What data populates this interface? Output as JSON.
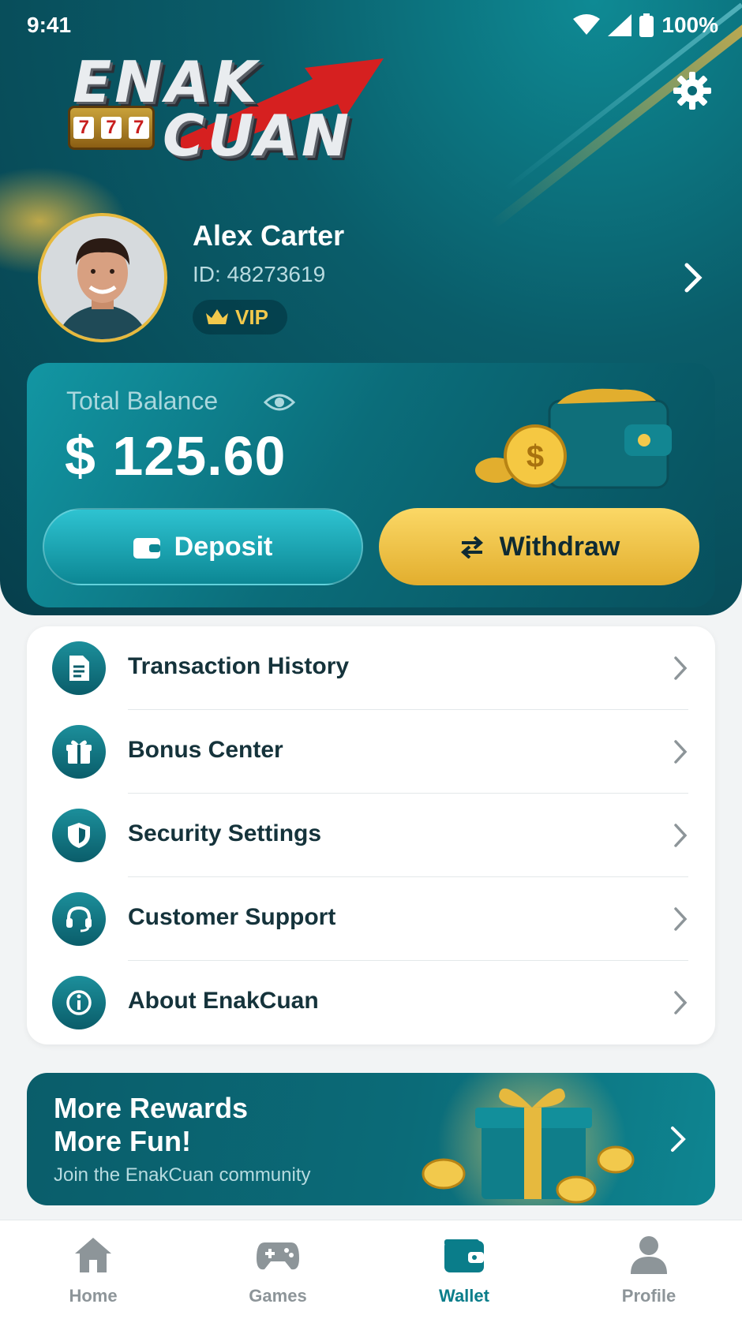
{
  "status_bar": {
    "time": "9:41",
    "battery": "100%"
  },
  "brand": {
    "logo_line1": "ENAK",
    "logo_line2": "CUAN",
    "slot_digits": [
      "7",
      "7",
      "7"
    ]
  },
  "user": {
    "name": "Alex Carter",
    "id_text": "ID: 48273619",
    "tier": "VIP"
  },
  "wallet": {
    "balance_label": "Total Balance",
    "balance": "$ 125.60",
    "deposit_label": "Deposit",
    "withdraw_label": "Withdraw"
  },
  "menu": {
    "items": [
      {
        "label": "Transaction History",
        "icon": "document-icon"
      },
      {
        "label": "Bonus Center",
        "icon": "gift-icon"
      },
      {
        "label": "Security Settings",
        "icon": "shield-icon"
      },
      {
        "label": "Customer Support",
        "icon": "headset-icon"
      },
      {
        "label": "About EnakCuan",
        "icon": "info-icon"
      }
    ]
  },
  "promo": {
    "line1": "More Rewards",
    "line2": "More Fun!",
    "subtitle": "Join the EnakCuan community"
  },
  "tabs": [
    {
      "label": "Home",
      "icon": "home-icon",
      "active": false
    },
    {
      "label": "Games",
      "icon": "gamepad-icon",
      "active": false
    },
    {
      "label": "Wallet",
      "icon": "wallet-icon",
      "active": true
    },
    {
      "label": "Profile",
      "icon": "person-icon",
      "active": false
    }
  ],
  "colors": {
    "primary": "#0a5d6a",
    "accent_gold": "#f2c94c",
    "active_tab": "#0a7d8a"
  }
}
